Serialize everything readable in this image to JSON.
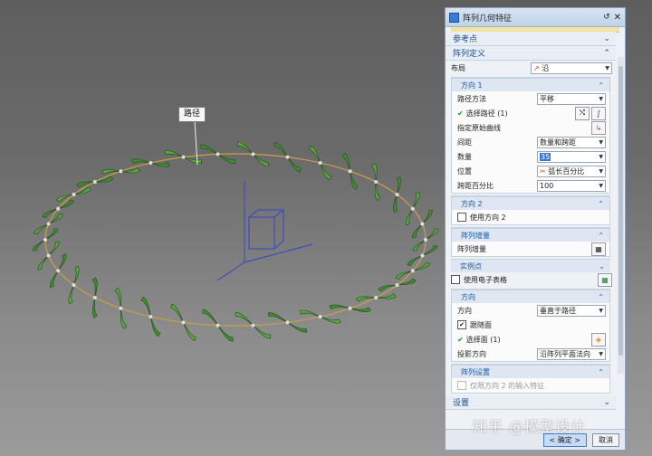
{
  "viewport": {
    "path_label": "路径"
  },
  "dialog": {
    "title": "阵列几何特征",
    "ref_point": "参考点",
    "array_def": "阵列定义",
    "layout_label": "布局",
    "layout_value": "沿",
    "dir1": {
      "header": "方向 1",
      "path_method_label": "路径方法",
      "path_method_value": "平移",
      "select_path": "选择路径 (1)",
      "start_curve": "指定原始曲线",
      "spacing_label": "间距",
      "spacing_value": "数量和跨距",
      "count_label": "数量",
      "count_value": "35",
      "position_label": "位置",
      "position_value": "弧长百分比",
      "span_label": "跨距百分比",
      "span_value": "100"
    },
    "dir2": {
      "header": "方向 2",
      "use_dir2": "使用方向 2"
    },
    "increment": {
      "header": "阵列增量",
      "label": "阵列增量"
    },
    "instance": {
      "header": "实例点",
      "use_spreadsheet": "使用电子表格"
    },
    "orientation": {
      "header": "方向",
      "label": "方向",
      "value": "垂直于路径",
      "follow_face": "跟随面",
      "select_face": "选择面 (1)",
      "projection_label": "投影方向",
      "projection_value": "沿阵列平面法向"
    },
    "settings_hdr": {
      "header": "阵列设置",
      "only_dir2": "仅限方向 2 的输入特征"
    },
    "settings": "设置",
    "ok": "< 确定 >",
    "cancel": "取消"
  },
  "watermark": "知乎 @模型设计",
  "colors": {
    "accent": "#1a4d8c",
    "helix_green": "#3f8f2e",
    "viewport_bg": "#6b6b6b"
  }
}
